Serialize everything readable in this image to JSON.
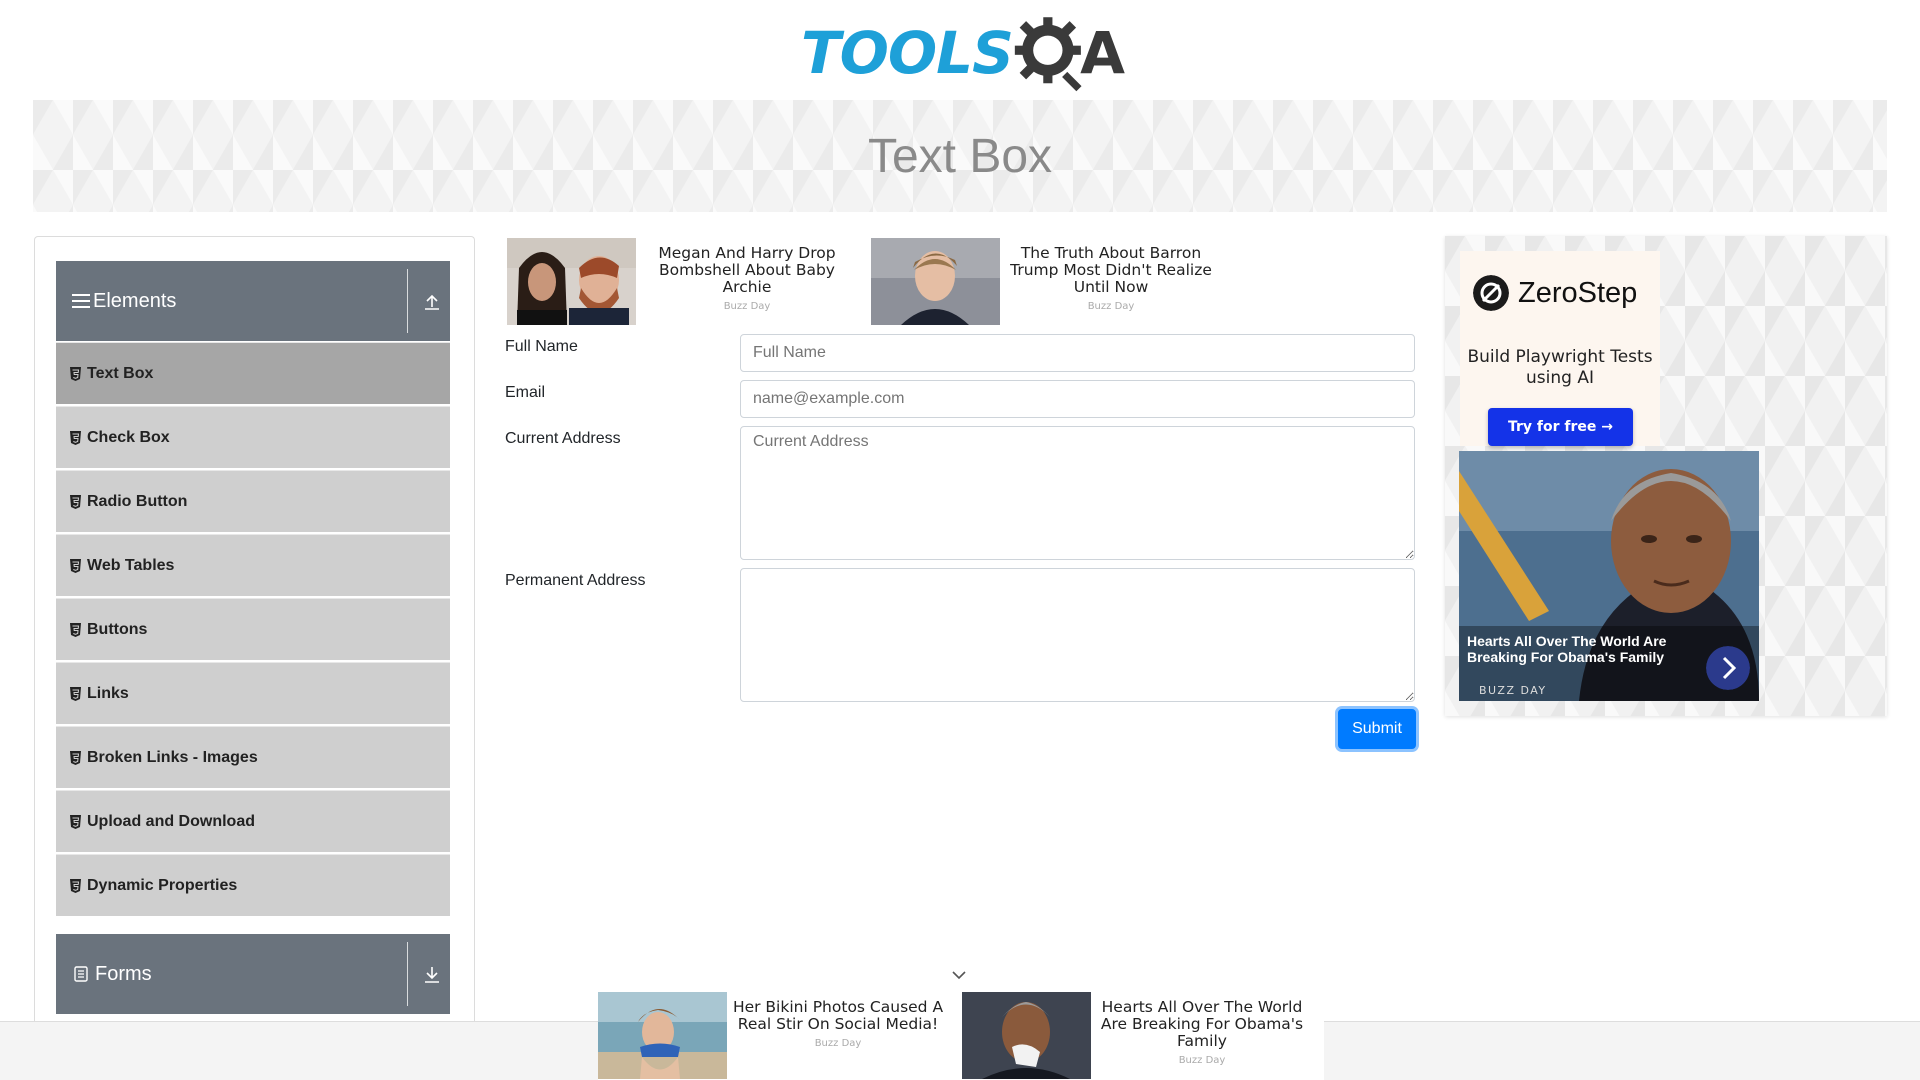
{
  "logo": {
    "part1": "TOOLS",
    "part2": "A"
  },
  "banner": {
    "title": "Text Box"
  },
  "sidebar": {
    "elements_header": "Elements",
    "forms_header": "Forms",
    "items": [
      {
        "label": "Text Box",
        "active": true
      },
      {
        "label": "Check Box"
      },
      {
        "label": "Radio Button"
      },
      {
        "label": "Web Tables"
      },
      {
        "label": "Buttons"
      },
      {
        "label": "Links"
      },
      {
        "label": "Broken Links - Images"
      },
      {
        "label": "Upload and Download"
      },
      {
        "label": "Dynamic Properties"
      }
    ]
  },
  "top_ads": [
    {
      "title": "Megan And Harry Drop Bombshell About Baby Archie",
      "source": "Buzz Day"
    },
    {
      "title": "The Truth About Barron Trump Most Didn't Realize Until Now",
      "source": "Buzz Day"
    }
  ],
  "form": {
    "full_name_label": "Full Name",
    "full_name_placeholder": "Full Name",
    "email_label": "Email",
    "email_placeholder": "name@example.com",
    "current_address_label": "Current Address",
    "current_address_placeholder": "Current Address",
    "permanent_address_label": "Permanent Address",
    "submit_label": "Submit"
  },
  "right_ad": {
    "brand": "ZeroStep",
    "tagline": "Build Playwright Tests using AI",
    "cta": "Try for free →",
    "story_title": "Hearts All Over The World Are Breaking For Obama's Family",
    "story_source": "BUZZ DAY"
  },
  "bottom_ads": [
    {
      "title": "Her Bikini Photos Caused A Real Stir On Social Media!",
      "source": "Buzz Day"
    },
    {
      "title": "Hearts All Over The World Are Breaking For Obama's Family",
      "source": "Buzz Day"
    }
  ],
  "colors": {
    "accent": "#007bff",
    "sidebar_header": "#6a737d",
    "menu_item": "#cfcfcf",
    "menu_active": "#a6a6a6",
    "logo_blue": "#1ea0d8"
  }
}
